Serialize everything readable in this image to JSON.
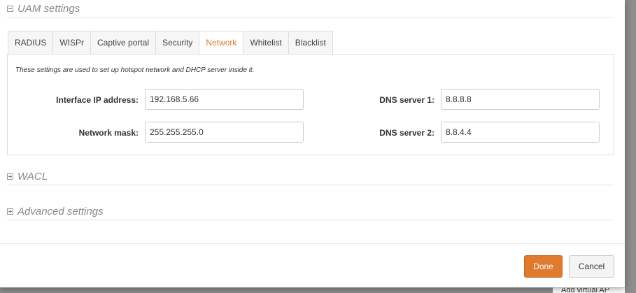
{
  "sections": {
    "uam": {
      "title": "UAM settings"
    },
    "wacl": {
      "title": "WACL"
    },
    "advanced": {
      "title": "Advanced settings"
    }
  },
  "tabs": [
    {
      "label": "RADIUS"
    },
    {
      "label": "WISPr"
    },
    {
      "label": "Captive portal"
    },
    {
      "label": "Security"
    },
    {
      "label": "Network"
    },
    {
      "label": "Whitelist"
    },
    {
      "label": "Blacklist"
    }
  ],
  "active_tab": "Network",
  "network": {
    "description": "These settings are used to set up hotspot network and DHCP server inside it.",
    "interface_ip": {
      "label": "Interface IP address:",
      "value": "192.168.5.66"
    },
    "network_mask": {
      "label": "Network mask:",
      "value": "255.255.255.0"
    },
    "dns1": {
      "label": "DNS server 1:",
      "value": "8.8.8.8"
    },
    "dns2": {
      "label": "DNS server 2:",
      "value": "8.8.4.4"
    }
  },
  "footer": {
    "done_label": "Done",
    "cancel_label": "Cancel"
  },
  "background": {
    "button_text": "Add virtual AP"
  },
  "colors": {
    "accent": "#e07a2e",
    "overlay": "#8d8d8d"
  },
  "icons": {
    "collapse": "minus-square-icon",
    "expand": "plus-square-icon"
  }
}
